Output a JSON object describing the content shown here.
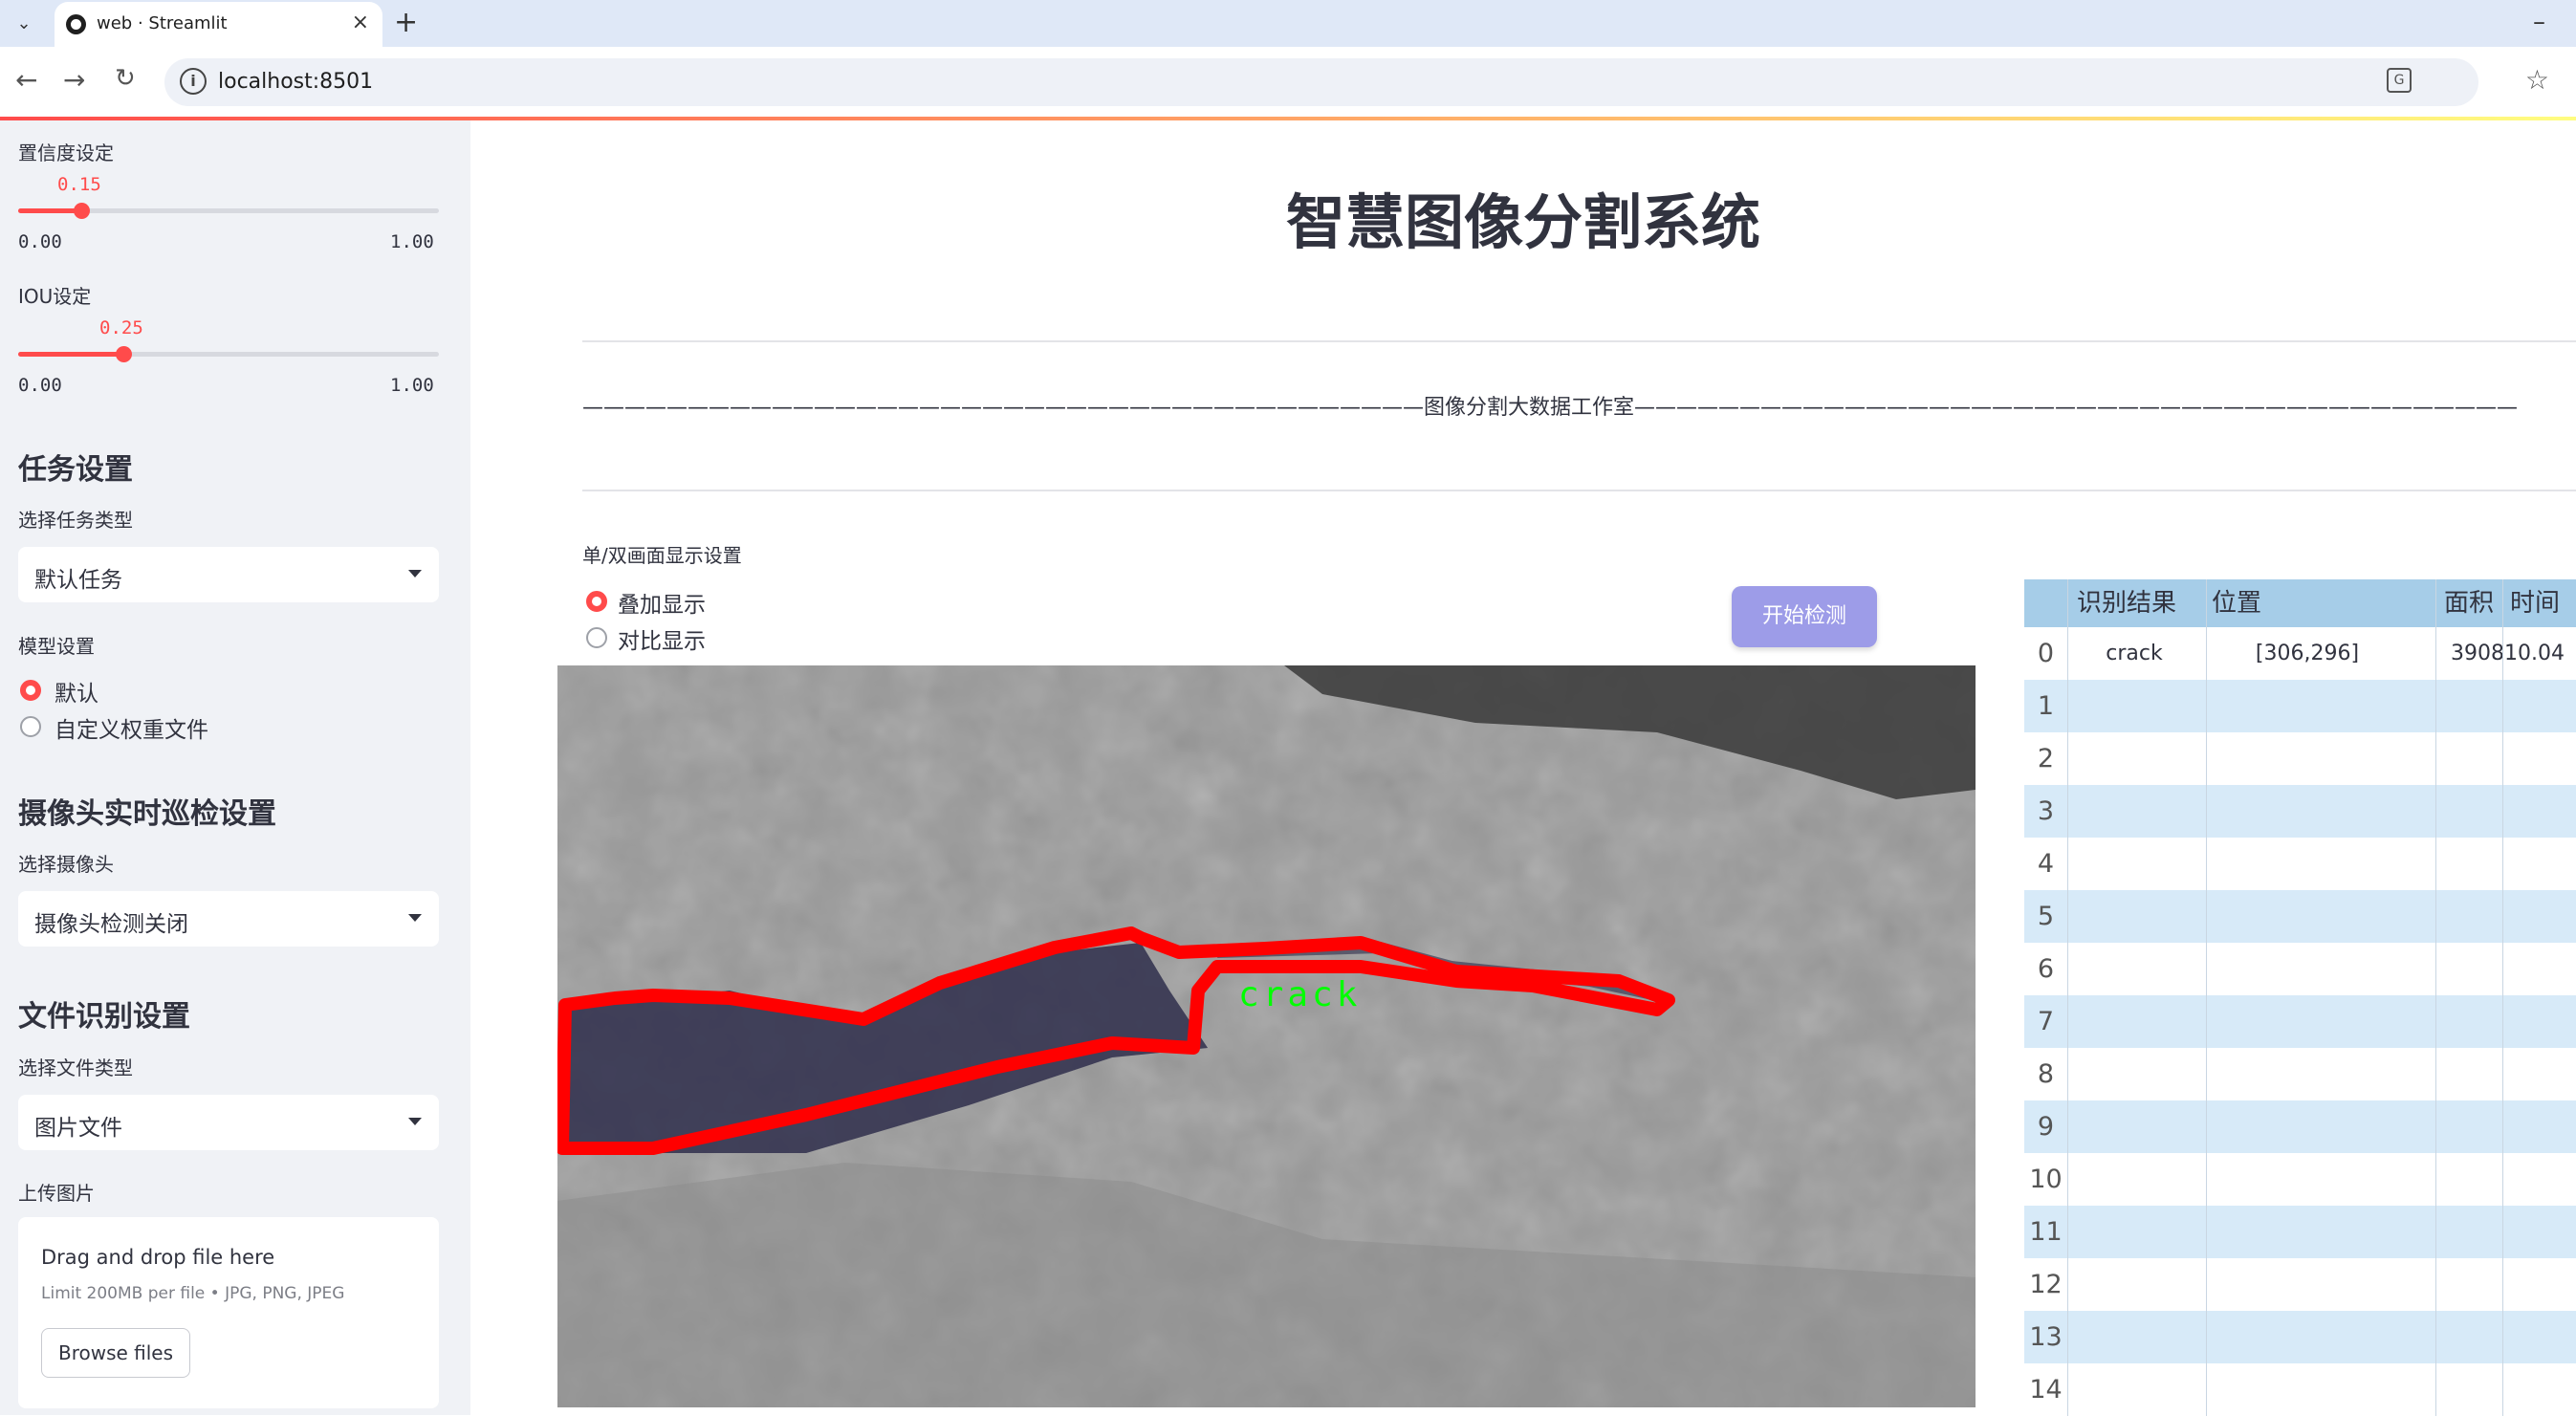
{
  "browser": {
    "tab_title": "web · Streamlit",
    "url": "localhost:8501",
    "new_tab": "+",
    "close": "×"
  },
  "sidebar": {
    "confidence": {
      "label": "置信度设定",
      "value": "0.15",
      "fraction": 0.15,
      "min": "0.00",
      "max": "1.00"
    },
    "iou": {
      "label": "IOU设定",
      "value": "0.25",
      "fraction": 0.25,
      "min": "0.00",
      "max": "1.00"
    },
    "task_heading": "任务设置",
    "task_type_label": "选择任务类型",
    "task_type_value": "默认任务",
    "model_label": "模型设置",
    "model_options": [
      "默认",
      "自定义权重文件"
    ],
    "camera_heading": "摄像头实时巡检设置",
    "camera_label": "选择摄像头",
    "camera_value": "摄像头检测关闭",
    "file_heading": "文件识别设置",
    "file_type_label": "选择文件类型",
    "file_type_value": "图片文件",
    "upload_label": "上传图片",
    "upload": {
      "drop_text": "Drag and drop file here",
      "limit_text": "Limit 200MB per file • JPG, PNG, JPEG",
      "browse": "Browse files"
    }
  },
  "main": {
    "title": "智慧图像分割系统",
    "divider_text": "————————————————————————————————————————图像分割大数据工作室——————————————————————————————————————————",
    "display_mode_label": "单/双画面显示设置",
    "display_options": [
      "叠加显示",
      "对比显示"
    ],
    "start_button": "开始检测",
    "detection_label": "crack"
  },
  "table": {
    "columns": [
      "识别结果",
      "位置",
      "面积",
      "时间"
    ],
    "rows": [
      {
        "index": "0",
        "result": "crack",
        "position": "[306,296]",
        "area": "39081",
        "time": "0.04"
      },
      {
        "index": "1"
      },
      {
        "index": "2"
      },
      {
        "index": "3"
      },
      {
        "index": "4"
      },
      {
        "index": "5"
      },
      {
        "index": "6"
      },
      {
        "index": "7"
      },
      {
        "index": "8"
      },
      {
        "index": "9"
      },
      {
        "index": "10"
      },
      {
        "index": "11"
      },
      {
        "index": "12"
      },
      {
        "index": "13"
      },
      {
        "index": "14"
      }
    ]
  },
  "colors": {
    "accent": "#ff4b4b",
    "button": "#9d9ce8",
    "table_header": "#a6cde8",
    "table_alt_row": "#d7eaf8",
    "mask_outline": "#ff0000",
    "label_text": "#00ff00"
  }
}
